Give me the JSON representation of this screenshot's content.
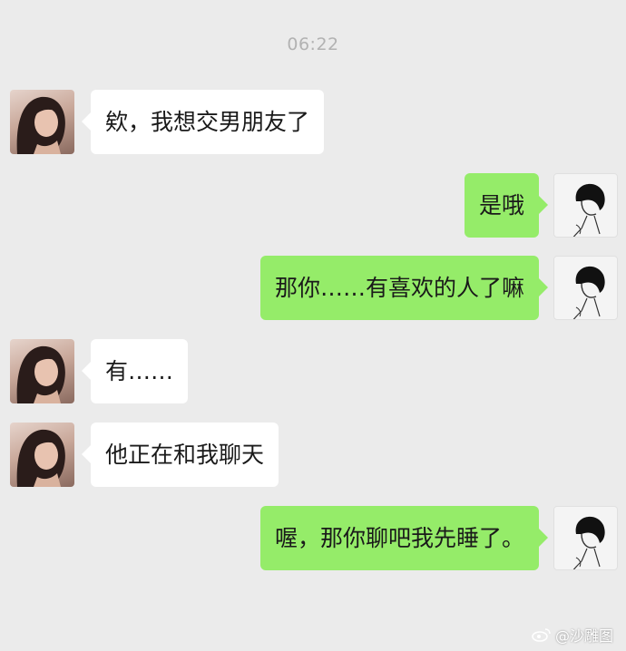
{
  "timestamp": "06:22",
  "messages": [
    {
      "side": "left",
      "avatar": "girl-avatar",
      "text": "欸，我想交男朋友了"
    },
    {
      "side": "right",
      "avatar": "boy-avatar",
      "text": "是哦"
    },
    {
      "side": "right",
      "avatar": "boy-avatar",
      "text": "那你……有喜欢的人了嘛"
    },
    {
      "side": "left",
      "avatar": "girl-avatar",
      "text": "有……"
    },
    {
      "side": "left",
      "avatar": "girl-avatar",
      "text": "他正在和我聊天"
    },
    {
      "side": "right",
      "avatar": "boy-avatar",
      "text": "喔，那你聊吧我先睡了。"
    }
  ],
  "watermark": {
    "icon": "weibo-icon",
    "text": "@沙雕图"
  },
  "colors": {
    "background": "#ebebeb",
    "incoming_bubble": "#ffffff",
    "outgoing_bubble": "#95ec69",
    "timestamp": "#b2b2b2"
  }
}
